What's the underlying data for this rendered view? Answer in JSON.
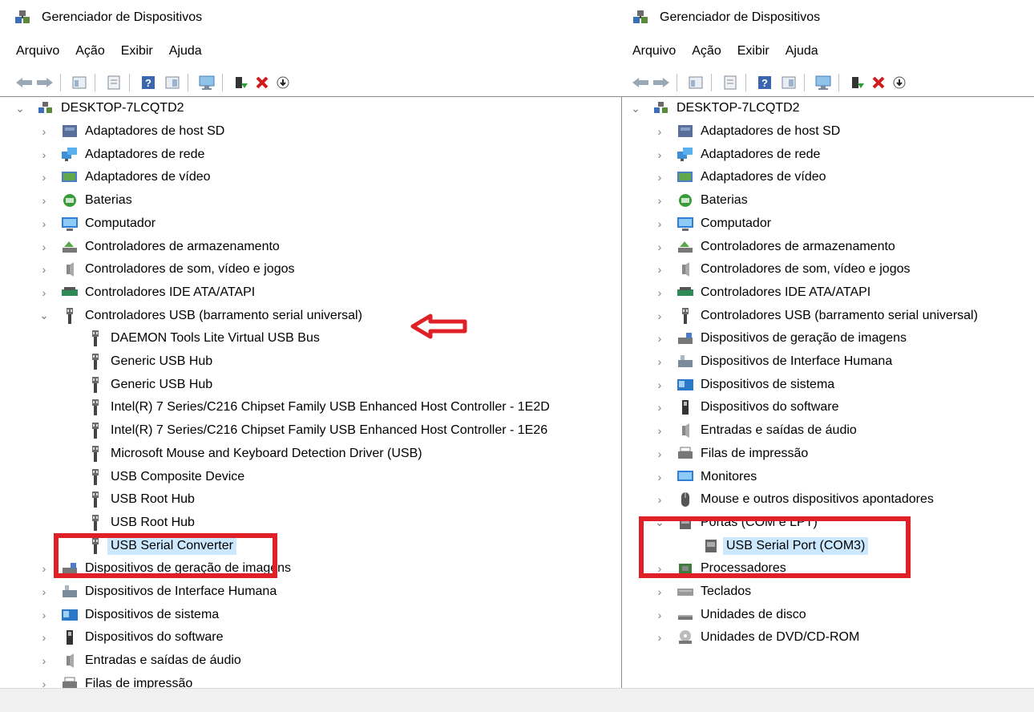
{
  "left": {
    "title": "Gerenciador de Dispositivos",
    "menu": [
      "Arquivo",
      "Ação",
      "Exibir",
      "Ajuda"
    ],
    "root": "DESKTOP-7LCQTD2",
    "categories_before": [
      {
        "label": "Adaptadores de host SD",
        "icon": "sd-host-icon"
      },
      {
        "label": "Adaptadores de rede",
        "icon": "network-adapter-icon"
      },
      {
        "label": "Adaptadores de vídeo",
        "icon": "display-adapter-icon"
      },
      {
        "label": "Baterias",
        "icon": "battery-icon"
      },
      {
        "label": "Computador",
        "icon": "computer-icon"
      },
      {
        "label": "Controladores de armazenamento",
        "icon": "storage-controller-icon"
      },
      {
        "label": "Controladores de som, vídeo e jogos",
        "icon": "speaker-icon"
      },
      {
        "label": "Controladores IDE ATA/ATAPI",
        "icon": "ide-controller-icon"
      }
    ],
    "usb_category": "Controladores USB (barramento serial universal)",
    "usb_children": [
      "DAEMON Tools Lite Virtual USB Bus",
      "Generic USB Hub",
      "Generic USB Hub",
      "Intel(R) 7 Series/C216 Chipset Family USB Enhanced Host Controller - 1E2D",
      "Intel(R) 7 Series/C216 Chipset Family USB Enhanced Host Controller - 1E26",
      "Microsoft Mouse and Keyboard Detection Driver (USB)",
      "USB Composite Device",
      "USB Root Hub",
      "USB Root Hub",
      "USB Serial Converter"
    ],
    "categories_after": [
      {
        "label": "Dispositivos de geração de imagens",
        "icon": "imaging-device-icon"
      },
      {
        "label": "Dispositivos de Interface Humana",
        "icon": "hid-icon"
      },
      {
        "label": "Dispositivos de sistema",
        "icon": "system-device-icon"
      },
      {
        "label": "Dispositivos do software",
        "icon": "software-device-icon"
      },
      {
        "label": "Entradas e saídas de áudio",
        "icon": "audio-io-icon"
      },
      {
        "label": "Filas de impressão",
        "icon": "print-queue-icon"
      }
    ]
  },
  "right": {
    "title": "Gerenciador de Dispositivos",
    "menu": [
      "Arquivo",
      "Ação",
      "Exibir",
      "Ajuda"
    ],
    "root": "DESKTOP-7LCQTD2",
    "categories": [
      {
        "label": "Adaptadores de host SD",
        "icon": "sd-host-icon"
      },
      {
        "label": "Adaptadores de rede",
        "icon": "network-adapter-icon"
      },
      {
        "label": "Adaptadores de vídeo",
        "icon": "display-adapter-icon"
      },
      {
        "label": "Baterias",
        "icon": "battery-icon"
      },
      {
        "label": "Computador",
        "icon": "computer-icon"
      },
      {
        "label": "Controladores de armazenamento",
        "icon": "storage-controller-icon"
      },
      {
        "label": "Controladores de som, vídeo e jogos",
        "icon": "speaker-icon"
      },
      {
        "label": "Controladores IDE ATA/ATAPI",
        "icon": "ide-controller-icon"
      },
      {
        "label": "Controladores USB (barramento serial universal)",
        "icon": "usb-icon"
      },
      {
        "label": "Dispositivos de geração de imagens",
        "icon": "imaging-device-icon"
      },
      {
        "label": "Dispositivos de Interface Humana",
        "icon": "hid-icon"
      },
      {
        "label": "Dispositivos de sistema",
        "icon": "system-device-icon"
      },
      {
        "label": "Dispositivos do software",
        "icon": "software-device-icon"
      },
      {
        "label": "Entradas e saídas de áudio",
        "icon": "audio-io-icon"
      },
      {
        "label": "Filas de impressão",
        "icon": "print-queue-icon"
      },
      {
        "label": "Monitores",
        "icon": "monitor-icon"
      },
      {
        "label": "Mouse e outros dispositivos apontadores",
        "icon": "mouse-icon"
      }
    ],
    "ports_category": "Portas (COM e LPT)",
    "ports_child": "USB Serial Port (COM3)",
    "categories_after": [
      {
        "label": "Processadores",
        "icon": "processor-icon"
      },
      {
        "label": "Teclados",
        "icon": "keyboard-icon"
      },
      {
        "label": "Unidades de disco",
        "icon": "disk-drive-icon"
      },
      {
        "label": "Unidades de DVD/CD-ROM",
        "icon": "dvd-icon"
      }
    ]
  },
  "colors": {
    "highlight": "#e02027",
    "selection": "#cce8ff",
    "chevron": "#7a7a7a"
  }
}
